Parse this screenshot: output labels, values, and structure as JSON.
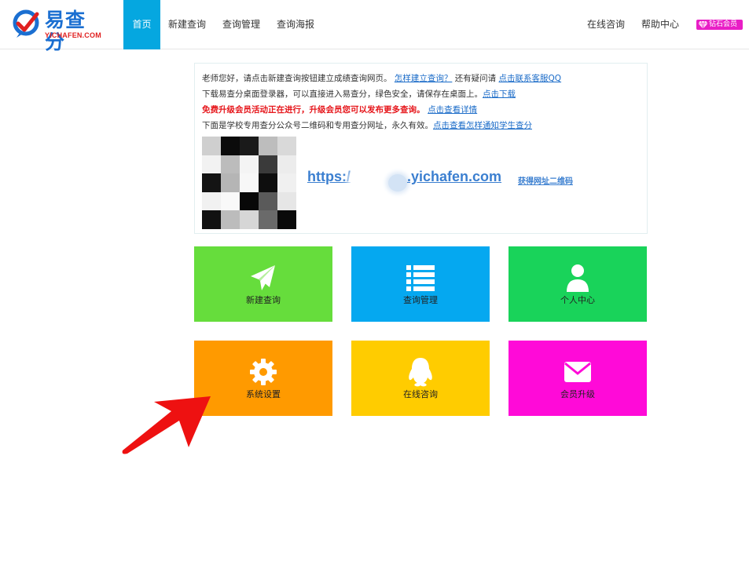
{
  "header": {
    "logo_cn": "易查分",
    "logo_en": "YICHAFEN.COM",
    "nav": [
      {
        "label": "首页",
        "active": true
      },
      {
        "label": "新建查询",
        "active": false
      },
      {
        "label": "查询管理",
        "active": false
      },
      {
        "label": "查询海报",
        "active": false
      }
    ],
    "right_nav": [
      {
        "label": "在线咨询"
      },
      {
        "label": "帮助中心"
      }
    ],
    "vip_label": "钻石会员"
  },
  "notice": {
    "line1_text": "老师您好，请点击新建查询按钮建立成绩查询网页。",
    "line1_link1": "怎样建立查询？",
    "line1_mid": "还有疑问请",
    "line1_link2": "点击联系客服QQ",
    "line2_text": "下载易查分桌面登录器，可以直接进入易查分，绿色安全，请保存在桌面上。",
    "line2_link": "点击下载",
    "line3_text": "免费升级会员活动正在进行，升级会员您可以发布更多查询。",
    "line3_link": "点击查看详情",
    "line4_text": "下面是学校专用查分公众号二维码和专用查分网址，永久有效。",
    "line4_link": "点击查看怎样通知学生查分",
    "url_prefix": "https:/",
    "url_suffix": ".yichafen.com",
    "qr_link": "获得网址二维码"
  },
  "tiles": [
    {
      "label": "新建查询",
      "icon": "paper-plane-icon",
      "color": "#66dd3c"
    },
    {
      "label": "查询管理",
      "icon": "list-icon",
      "color": "#05a8f0"
    },
    {
      "label": "个人中心",
      "icon": "user-icon",
      "color": "#19d35a"
    },
    {
      "label": "系统设置",
      "icon": "gear-icon",
      "color": "#ff9a00"
    },
    {
      "label": "在线咨询",
      "icon": "qq-penguin-icon",
      "color": "#ffcc00"
    },
    {
      "label": "会员升级",
      "icon": "envelope-icon",
      "color": "#ff0ad8"
    }
  ],
  "colors": {
    "accent": "#05a7e0",
    "link": "#1a6bc8",
    "alert_red": "#e6161b",
    "arrow_red": "#ee1111"
  }
}
